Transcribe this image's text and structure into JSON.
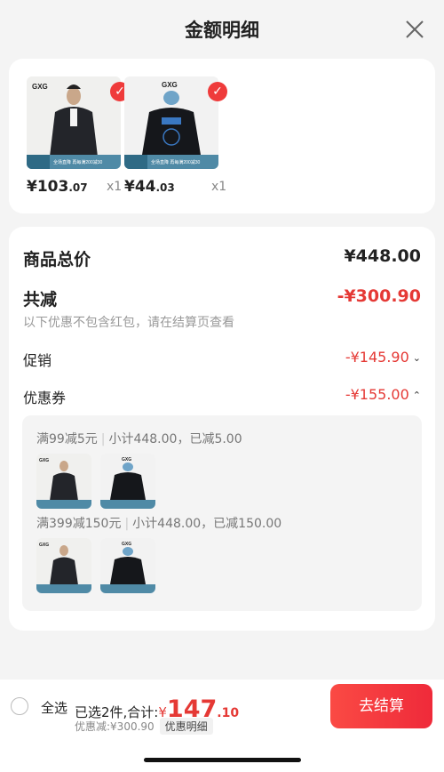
{
  "header": {
    "title": "金额明细",
    "close_icon": "close-icon"
  },
  "products": [
    {
      "brand": "GXG",
      "banner": "全场直降 再每满200减30",
      "price_main": "¥103",
      "price_cents": ".07",
      "qty": "x1",
      "view": "front"
    },
    {
      "brand": "GXG",
      "banner": "全场直降 再每满200减30",
      "price_main": "¥44",
      "price_cents": ".03",
      "qty": "x1",
      "view": "back"
    }
  ],
  "summary": {
    "total_label": "商品总价",
    "total_value": "¥448.00",
    "reduce_label": "共减",
    "reduce_value": "-¥300.90",
    "note": "以下优惠不包含红包，请在结算页查看",
    "promo_label": "促销",
    "promo_value": "-¥145.90",
    "coupon_label": "优惠券",
    "coupon_value": "-¥155.00"
  },
  "coupons": [
    {
      "rule": "满99减5元",
      "detail": "小计448.00，已减5.00"
    },
    {
      "rule": "满399减150元",
      "detail": "小计448.00，已减150.00"
    }
  ],
  "bottom": {
    "select_all": "全选",
    "selected_text": "已选2件,合计:",
    "currency": "¥",
    "amount_main": "147",
    "amount_cents": ".10",
    "discount": "优惠减:¥300.90",
    "detail_tag": "优惠明细",
    "checkout": "去结算"
  },
  "colors": {
    "accent": "#e53935",
    "button": "#ef2a3a"
  }
}
